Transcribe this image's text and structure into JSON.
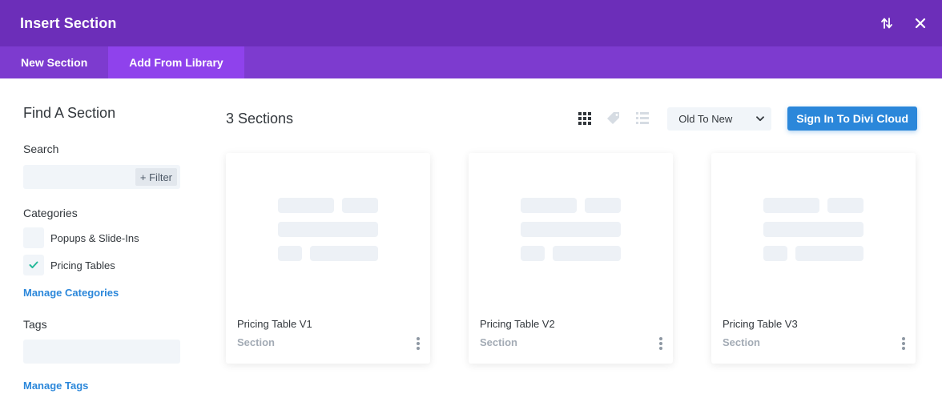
{
  "header": {
    "title": "Insert Section",
    "sort_icon": "sort-arrows-icon",
    "close_icon": "close-icon",
    "bg_color": "#6c2eb9"
  },
  "tabs": [
    {
      "label": "New Section",
      "active": false
    },
    {
      "label": "Add From Library",
      "active": true
    }
  ],
  "sidebar": {
    "title": "Find A Section",
    "search_label": "Search",
    "search_value": "",
    "filter_label": "+ Filter",
    "categories_label": "Categories",
    "categories": [
      {
        "label": "Popups & Slide-Ins",
        "checked": false
      },
      {
        "label": "Pricing Tables",
        "checked": true
      }
    ],
    "manage_categories": "Manage Categories",
    "tags_label": "Tags",
    "tags_value": "",
    "manage_tags": "Manage Tags"
  },
  "main": {
    "count": "3 Sections",
    "view_icons": [
      "grid-view-icon",
      "tag-view-icon",
      "list-view-icon"
    ],
    "sort_value": "Old To New",
    "cloud_button": "Sign In To Divi Cloud",
    "accent_color": "#2b87da",
    "cards": [
      {
        "title": "Pricing Table V1",
        "type": "Section"
      },
      {
        "title": "Pricing Table V2",
        "type": "Section"
      },
      {
        "title": "Pricing Table V3",
        "type": "Section"
      }
    ]
  }
}
